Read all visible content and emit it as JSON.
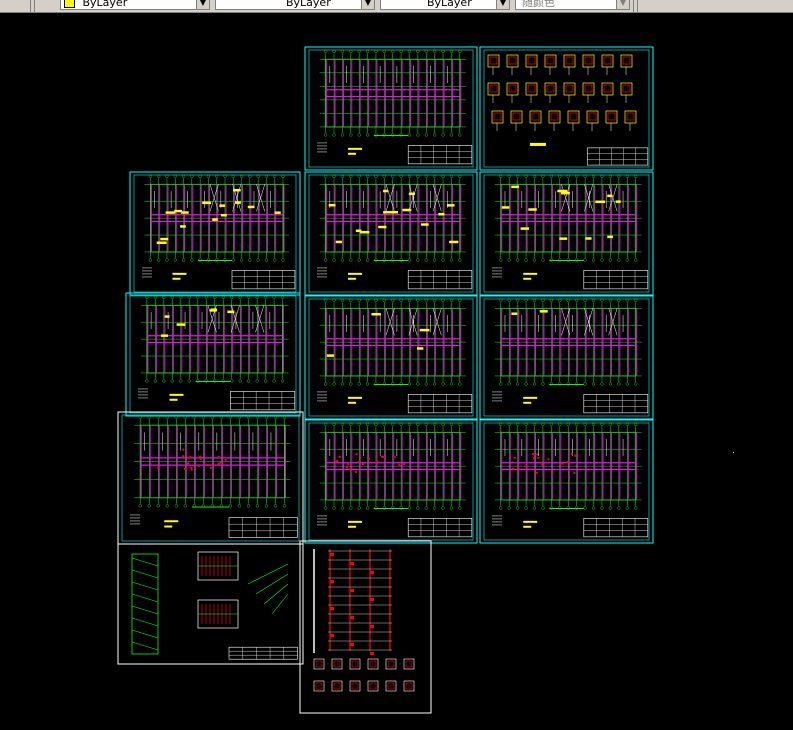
{
  "toolbar": {
    "color_combo": "ByLayer",
    "linetype_combo": "ByLayer",
    "lineweight_combo": "ByLayer",
    "plotstyle_combo": "随颜色"
  },
  "colors": {
    "background": "#000000",
    "sheet_border_cyan": "#00ffff",
    "sheet_border_white": "#ffffff",
    "grid_green": "#00ff00",
    "beam_magenta": "#ff00ff",
    "tag_yellow": "#ffff00",
    "detail_red": "#ff0000",
    "toolbar_gray": "#d4d0c8"
  },
  "icons": [
    "color-swatch-icon",
    "dropdown-arrow-icon"
  ]
}
